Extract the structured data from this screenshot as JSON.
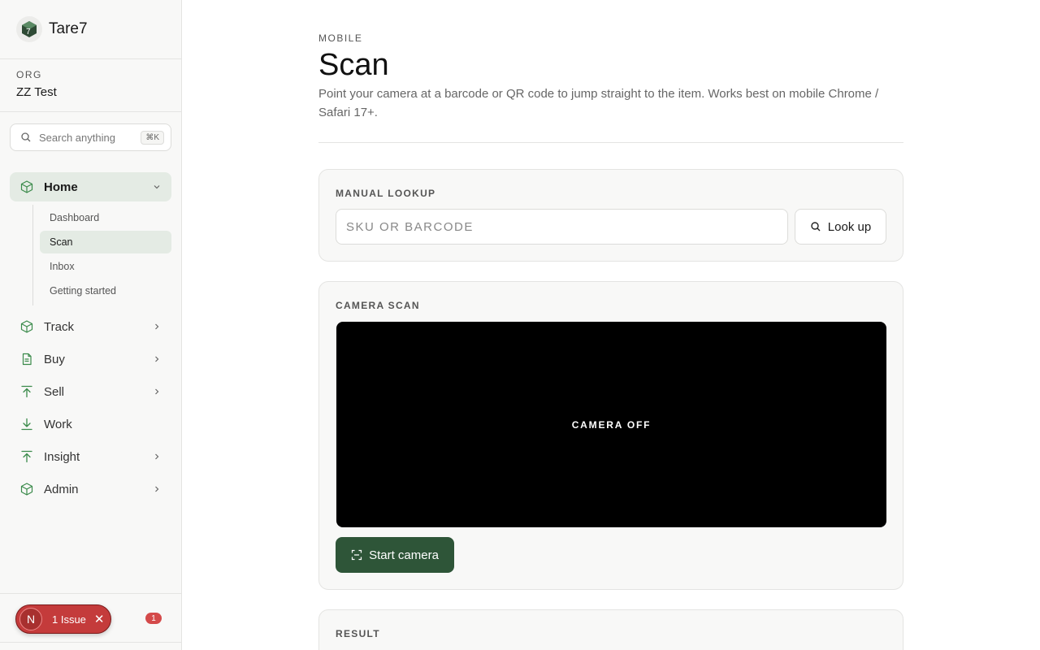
{
  "brand": {
    "name": "Tare7"
  },
  "org": {
    "label": "ORG",
    "name": "ZZ Test"
  },
  "search": {
    "placeholder": "Search anything",
    "shortcut": "⌘K"
  },
  "nav": {
    "items": [
      {
        "label": "Home",
        "icon": "box-icon",
        "expanded": true
      },
      {
        "label": "Track",
        "icon": "box-icon"
      },
      {
        "label": "Buy",
        "icon": "document-icon"
      },
      {
        "label": "Sell",
        "icon": "arrow-up-icon"
      },
      {
        "label": "Work",
        "icon": "download-icon"
      },
      {
        "label": "Insight",
        "icon": "arrow-up-icon"
      },
      {
        "label": "Admin",
        "icon": "box-icon"
      }
    ],
    "home_sub": [
      "Dashboard",
      "Scan",
      "Inbox",
      "Getting started"
    ]
  },
  "issues": {
    "avatar": "N",
    "label": "1 Issue",
    "count": "1"
  },
  "page": {
    "eyebrow": "MOBILE",
    "title": "Scan",
    "description": "Point your camera at a barcode or QR code to jump straight to the item. Works best on mobile Chrome / Safari 17+."
  },
  "manual_lookup": {
    "label": "MANUAL LOOKUP",
    "placeholder": "SKU OR BARCODE",
    "button": "Look up"
  },
  "camera_scan": {
    "label": "CAMERA SCAN",
    "status": "CAMERA OFF",
    "button": "Start camera"
  },
  "result": {
    "label": "RESULT"
  },
  "colors": {
    "accent": "#2e5538",
    "active_bg": "#e4ebe4",
    "icon_green": "#3a8a4a",
    "issue_red": "#c43b3b"
  }
}
